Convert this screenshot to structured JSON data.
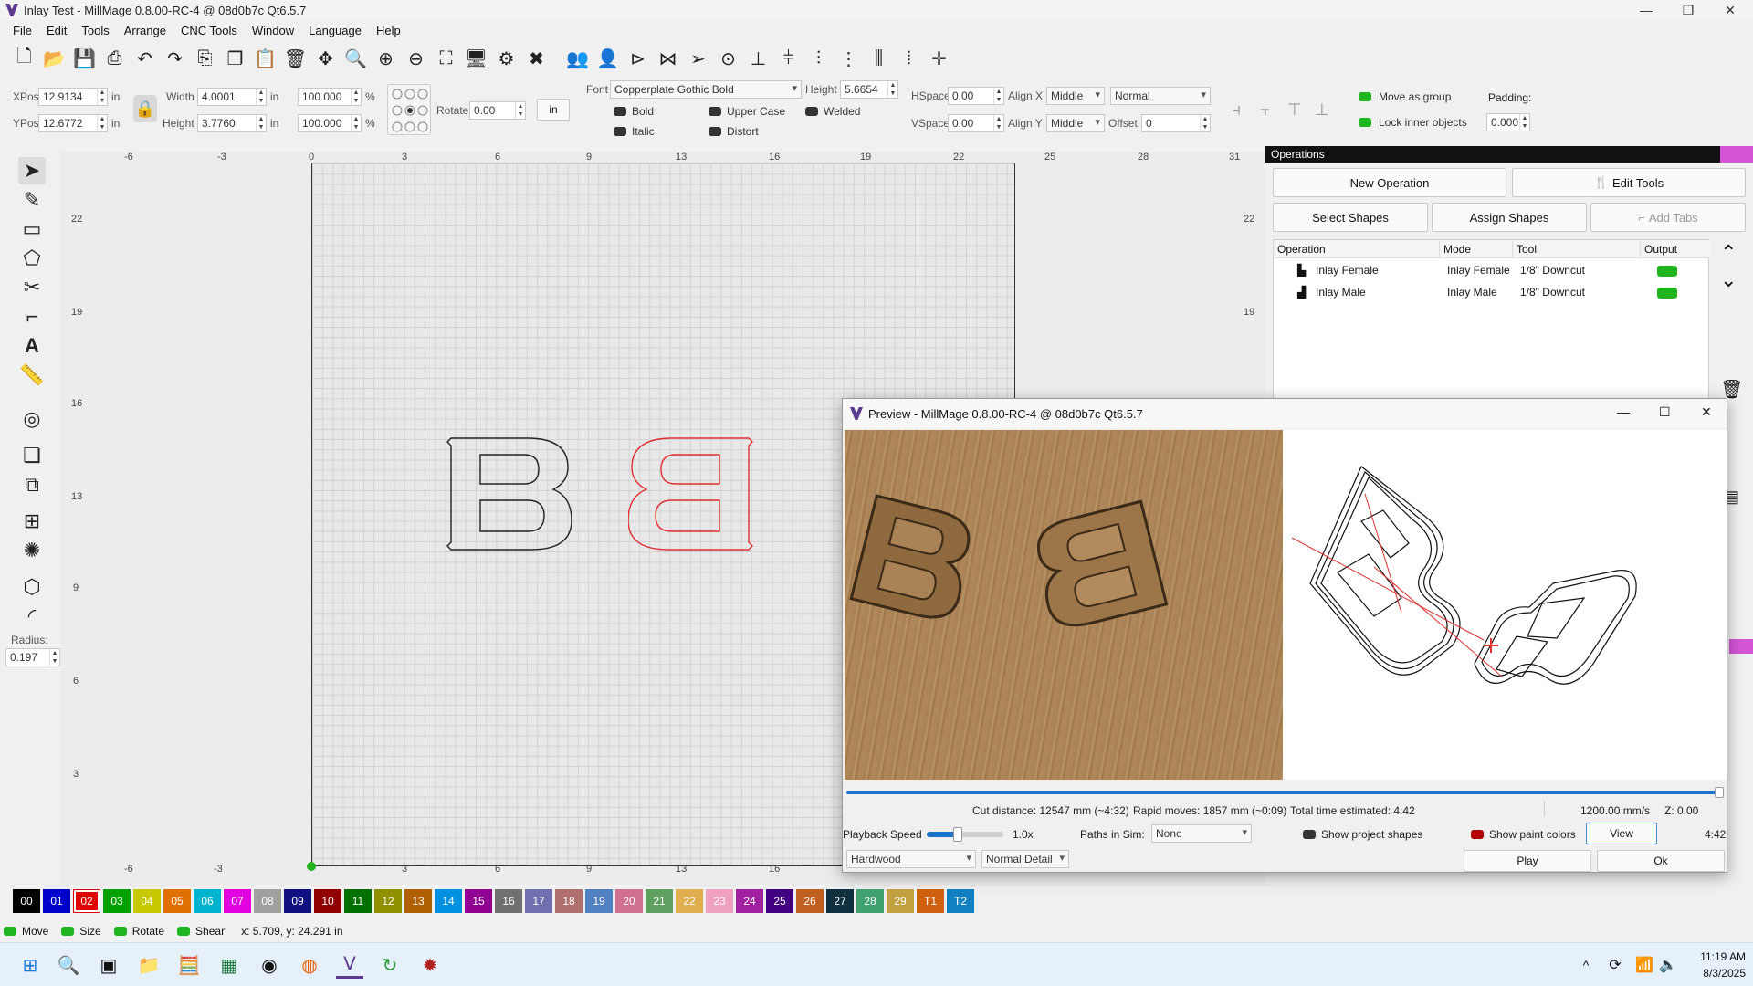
{
  "window": {
    "title": "Inlay Test - MillMage 0.8.00-RC-4 @ 08d0b7c Qt6.5.7"
  },
  "menu": [
    "File",
    "Edit",
    "Tools",
    "Arrange",
    "CNC Tools",
    "Window",
    "Language",
    "Help"
  ],
  "props": {
    "xpos_label": "XPos",
    "xpos": "12.9134",
    "ypos_label": "YPos",
    "ypos": "12.6772",
    "unit": "in",
    "width_label": "Width",
    "width": "4.0001",
    "height_label": "Height",
    "height": "3.7760",
    "scale_w": "100.000",
    "scale_h": "100.000",
    "pct": "%",
    "rotate_label": "Rotate",
    "rotate": "0.00",
    "units_btn": "in",
    "font_label": "Font",
    "font": "Copperplate Gothic Bold",
    "font_height_label": "Height",
    "font_height": "5.6654",
    "hspace_label": "HSpace",
    "hspace": "0.00",
    "vspace_label": "VSpace",
    "vspace": "0.00",
    "alignx_label": "Align X",
    "alignx": "Middle",
    "aligny_label": "Align Y",
    "aligny": "Middle",
    "normal": "Normal",
    "offset_label": "Offset",
    "offset": "0",
    "bold": "Bold",
    "italic": "Italic",
    "upper": "Upper Case",
    "distort": "Distort",
    "welded": "Welded",
    "move_group": "Move as group",
    "lock_inner": "Lock inner objects",
    "padding_label": "Padding:",
    "padding": "0.000"
  },
  "left": {
    "radius_label": "Radius:",
    "radius": "0.197"
  },
  "ruler": {
    "top": [
      "-6",
      "-3",
      "0",
      "3",
      "6",
      "9",
      "13",
      "16",
      "19",
      "22",
      "25",
      "28",
      "31"
    ],
    "left": [
      "22",
      "19",
      "16",
      "13",
      "9",
      "6",
      "3"
    ],
    "right": [
      "22",
      "19"
    ],
    "bottom": [
      "-6",
      "-3",
      "3",
      "6",
      "9",
      "13",
      "16"
    ]
  },
  "operations": {
    "title": "Operations",
    "new_op": "New Operation",
    "edit_tools": "Edit Tools",
    "select_shapes": "Select Shapes",
    "assign_shapes": "Assign Shapes",
    "add_tabs": "Add Tabs",
    "columns": [
      "Operation",
      "Mode",
      "Tool",
      "Output"
    ],
    "rows": [
      {
        "op": "Inlay Female",
        "mode": "Inlay Female",
        "tool": "1/8\" Downcut"
      },
      {
        "op": "Inlay Male",
        "mode": "Inlay Male",
        "tool": "1/8\" Downcut"
      }
    ]
  },
  "preview": {
    "title": "Preview - MillMage 0.8.00-RC-4 @ 08d0b7c Qt6.5.7",
    "progress": 1.0,
    "cut": "Cut distance: 12547 mm (~4:32)",
    "rapid": "Rapid moves: 1857 mm (~0:09)",
    "total": "Total time estimated: 4:42",
    "speed": "1200.00 mm/s",
    "z": "Z: 0.00",
    "playback_label": "Playback Speed",
    "playback": "1.0x",
    "playback_fraction": 0.4,
    "paths_label": "Paths in Sim:",
    "paths": "None",
    "show_project": "Show project shapes",
    "show_paint": "Show paint colors",
    "view": "View",
    "time": "4:42",
    "material": "Hardwood",
    "detail": "Normal Detail",
    "play": "Play",
    "ok": "Ok"
  },
  "palette": [
    {
      "label": "00",
      "color": "#000000"
    },
    {
      "label": "01",
      "color": "#0000cc"
    },
    {
      "label": "02",
      "color": "#e00000"
    },
    {
      "label": "03",
      "color": "#00a000"
    },
    {
      "label": "04",
      "color": "#c8c800"
    },
    {
      "label": "05",
      "color": "#e07000"
    },
    {
      "label": "06",
      "color": "#00b4d0"
    },
    {
      "label": "07",
      "color": "#e000e0"
    },
    {
      "label": "08",
      "color": "#a0a0a0"
    },
    {
      "label": "09",
      "color": "#101080"
    },
    {
      "label": "10",
      "color": "#900000"
    },
    {
      "label": "11",
      "color": "#007000"
    },
    {
      "label": "12",
      "color": "#909000"
    },
    {
      "label": "13",
      "color": "#b06000"
    },
    {
      "label": "14",
      "color": "#0090e0"
    },
    {
      "label": "15",
      "color": "#900090"
    },
    {
      "label": "16",
      "color": "#707070"
    },
    {
      "label": "17",
      "color": "#7070b0"
    },
    {
      "label": "18",
      "color": "#b07070"
    },
    {
      "label": "19",
      "color": "#5080c0"
    },
    {
      "label": "20",
      "color": "#d07090"
    },
    {
      "label": "21",
      "color": "#60a060"
    },
    {
      "label": "22",
      "color": "#e0b050"
    },
    {
      "label": "23",
      "color": "#f0a0c0"
    },
    {
      "label": "24",
      "color": "#a020a0"
    },
    {
      "label": "25",
      "color": "#400080"
    },
    {
      "label": "26",
      "color": "#c06020"
    },
    {
      "label": "27",
      "color": "#103040"
    },
    {
      "label": "28",
      "color": "#40a070"
    },
    {
      "label": "29",
      "color": "#c0a040"
    },
    {
      "label": "T1",
      "color": "#d06010"
    },
    {
      "label": "T2",
      "color": "#1080c0"
    }
  ],
  "status": {
    "move": "Move",
    "size": "Size",
    "rotate": "Rotate",
    "shear": "Shear",
    "coords": "x: 5.709, y: 24.291 in"
  },
  "taskbar": {
    "time": "11:19 AM",
    "date": "8/3/2025"
  }
}
